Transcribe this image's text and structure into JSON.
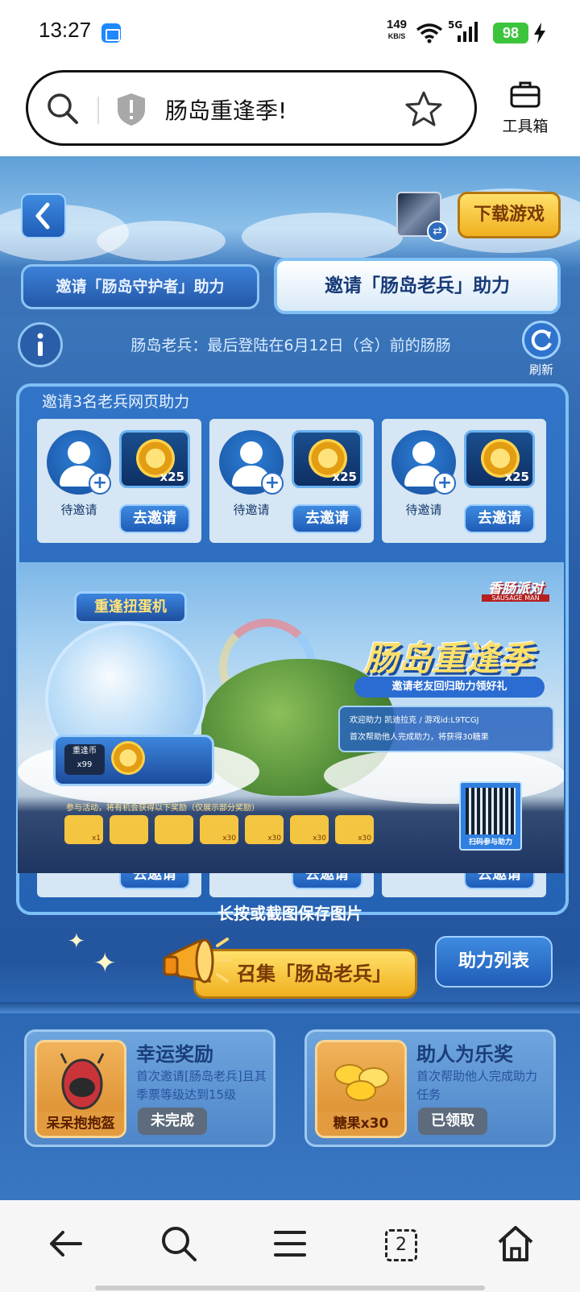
{
  "status_bar": {
    "time": "13:27",
    "net_speed": "149",
    "net_unit": "KB/S",
    "signal": "5G",
    "battery": "98"
  },
  "browser": {
    "page_title": "肠岛重逢季!",
    "toolbox_label": "工具箱"
  },
  "header": {
    "download_label": "下载游戏"
  },
  "tabs": [
    {
      "label": "邀请「肠岛守护者」助力",
      "active": false
    },
    {
      "label": "邀请「肠岛老兵」助力",
      "active": true
    }
  ],
  "info": {
    "text": "肠岛老兵：最后登陆在6月12日（含）前的肠肠",
    "refresh_label": "刷新"
  },
  "invite_panel": {
    "title": "邀请3名老兵网页助力",
    "slots": [
      {
        "status": "待邀请",
        "reward_count": "x25",
        "button": "去邀请"
      },
      {
        "status": "待邀请",
        "reward_count": "x25",
        "button": "去邀请"
      },
      {
        "status": "待邀请",
        "reward_count": "x25",
        "button": "去邀请"
      }
    ]
  },
  "poster": {
    "brand": "香肠派对",
    "brand_en": "SAUSAGE MAN",
    "machine_label": "重逢扭蛋机",
    "machine_coin_label": "重逢币",
    "machine_coin_count": "x99",
    "headline": "肠岛重逢季",
    "subheadline": "邀请老友回归助力领好礼",
    "welcome_line1": "欢迎助力 凯迪拉克 / 游戏id:L9TCGJ",
    "welcome_line2": "首次帮助他人完成助力，将获得30糖果",
    "rewards_caption": "参与活动，将有机会获得以下奖励（仅展示部分奖励）",
    "reward_items": [
      "x1",
      "",
      "",
      "x30",
      "x30",
      "x30",
      "x30"
    ],
    "qr_label": "扫码参与助力"
  },
  "save_tip": "长按或截图保存图片",
  "actions": {
    "summon_label": "召集「肠岛老兵」",
    "list_label": "助力列表"
  },
  "rewards": [
    {
      "title": "幸运奖励",
      "desc": "首次邀请[肠岛老兵]且其季票等级达到15级",
      "item": "呆呆抱抱盔",
      "status": "未完成"
    },
    {
      "title": "助人为乐奖",
      "desc": "首次帮助他人完成助力任务",
      "item": "糖果x30",
      "status": "已领取"
    }
  ],
  "nav": {
    "tabs_count": "2"
  },
  "colors": {
    "gold": "#f0b020",
    "blue": "#2a5ea8",
    "status_green": "#3cc53c"
  }
}
